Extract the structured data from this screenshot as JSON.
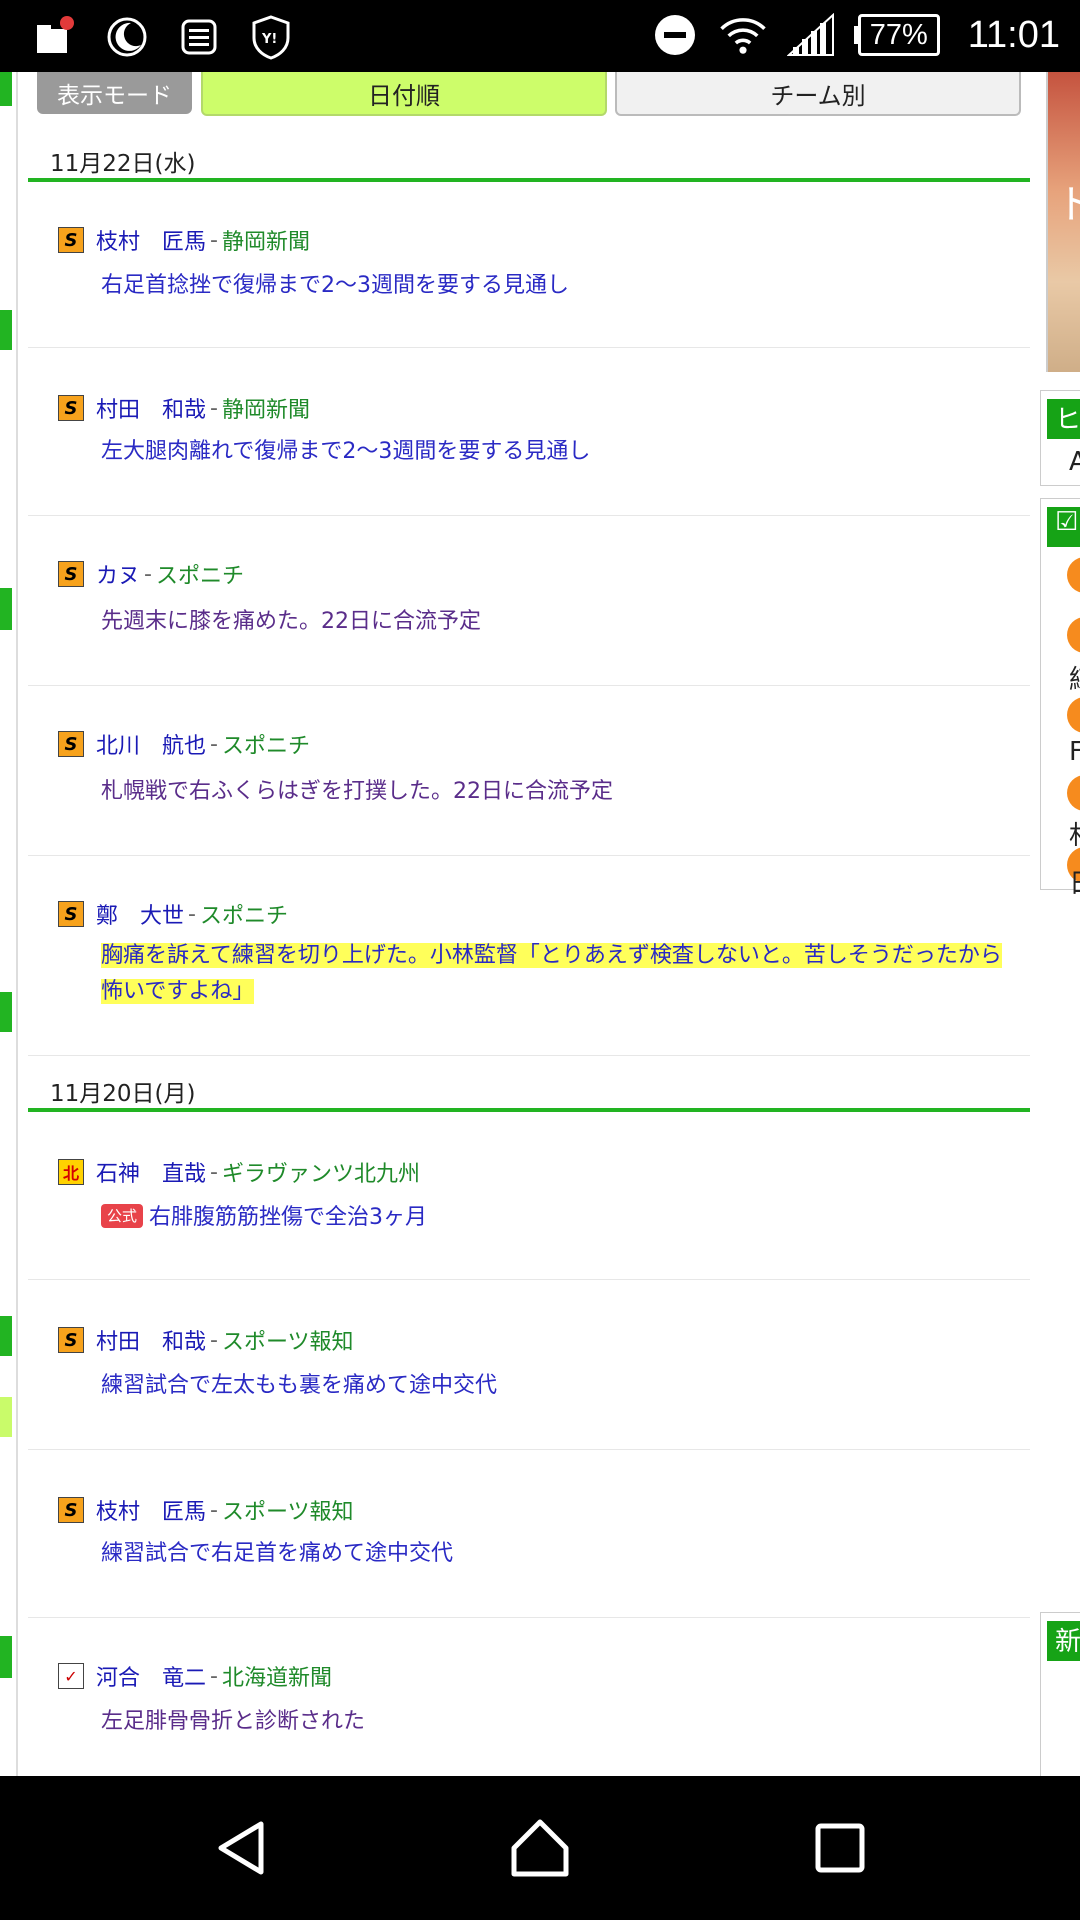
{
  "status_bar": {
    "time": "11:01",
    "battery_percent": "77%",
    "icons": [
      "folder-notification-icon",
      "moon-icon",
      "clipboard-icon",
      "yahoo-shield-icon",
      "do-not-disturb-icon",
      "wifi-icon",
      "signal-icon",
      "battery-icon"
    ]
  },
  "mode_bar": {
    "label": "表示モード",
    "options": [
      {
        "label": "日付順",
        "active": true
      },
      {
        "label": "チーム別",
        "active": false
      }
    ]
  },
  "sections": [
    {
      "date": "11月22日(水)",
      "entries": [
        {
          "icon": "team-s-icon",
          "player": "枝村　匠馬",
          "source": "静岡新聞",
          "body": "右足首捻挫で復帰まで2〜3週間を要する見通し",
          "official": false,
          "highlight": false,
          "style": "blue"
        },
        {
          "icon": "team-s-icon",
          "player": "村田　和哉",
          "source": "静岡新聞",
          "body": "左大腿肉離れで復帰まで2〜3週間を要する見通し",
          "official": false,
          "highlight": false,
          "style": "blue"
        },
        {
          "icon": "team-s-icon",
          "player": "カヌ",
          "source": "スポニチ",
          "body": "先週末に膝を痛めた。22日に合流予定",
          "official": false,
          "highlight": false,
          "style": "purple"
        },
        {
          "icon": "team-s-icon",
          "player": "北川　航也",
          "source": "スポニチ",
          "body": "札幌戦で右ふくらはぎを打撲した。22日に合流予定",
          "official": false,
          "highlight": false,
          "style": "purple"
        },
        {
          "icon": "team-s-icon",
          "player": "鄭　大世",
          "source": "スポニチ",
          "body": "胸痛を訴えて練習を切り上げた。小林監督「とりあえず検査しないと。苦しそうだったから怖いですよね」",
          "official": false,
          "highlight": true,
          "style": "blue"
        }
      ]
    },
    {
      "date": "11月20日(月)",
      "entries": [
        {
          "icon": "team-kitakyushu-icon",
          "player": "石神　直哉",
          "source": "ギラヴァンツ北九州",
          "body": "右腓腹筋筋挫傷で全治3ヶ月",
          "official": true,
          "official_label": "公式",
          "highlight": false,
          "style": "blue"
        },
        {
          "icon": "team-s-icon",
          "player": "村田　和哉",
          "source": "スポーツ報知",
          "body": "練習試合で左太もも裏を痛めて途中交代",
          "official": false,
          "highlight": false,
          "style": "blue"
        },
        {
          "icon": "team-s-icon",
          "player": "枝村　匠馬",
          "source": "スポーツ報知",
          "body": "練習試合で右足首を痛めて途中交代",
          "official": false,
          "highlight": false,
          "style": "blue"
        },
        {
          "icon": "team-hokkaido-icon",
          "player": "河合　竜二",
          "source": "北海道新聞",
          "body": "左足腓骨骨折と診断された",
          "official": false,
          "highlight": false,
          "style": "purple"
        }
      ]
    }
  ],
  "sidebar_slivers": {
    "banner_char": "ト",
    "box1_header": "ヒ",
    "box1_text": "A",
    "box2_letters": [
      "",
      "練",
      "F",
      "村",
      "日"
    ],
    "box3_header": "新"
  },
  "colors": {
    "accent_green": "#22b422",
    "active_tab": "#cdfd6a",
    "link_blue": "#1a1ab5",
    "source_green": "#1f8a2a",
    "highlight": "#ffff5a",
    "official_red": "#e8434a"
  }
}
